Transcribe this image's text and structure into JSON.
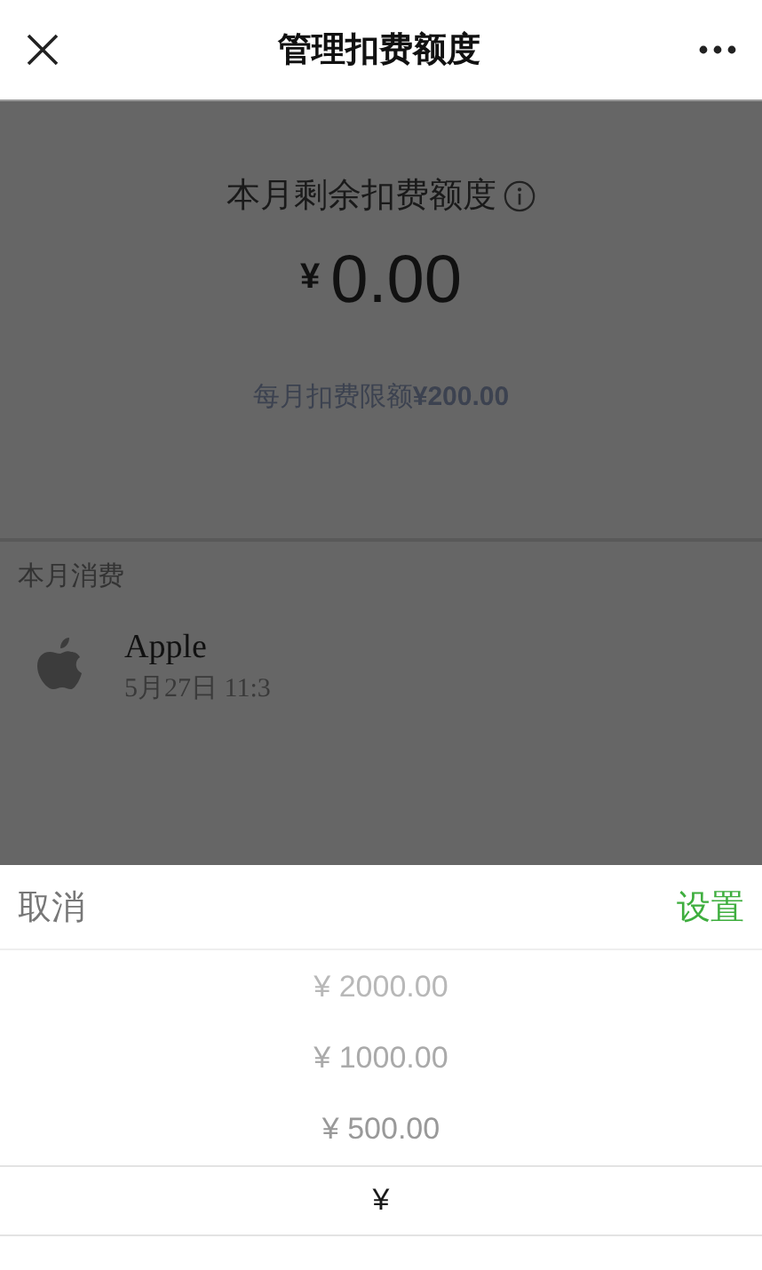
{
  "nav": {
    "title": "管理扣费额度"
  },
  "summary": {
    "label": "本月剩余扣费额度",
    "currency": "¥",
    "amount": "0.00",
    "limit": "每月扣费限额**¥200.00**"
  },
  "spending": {
    "heading": "本月消费",
    "items": [
      {
        "name": "Apple",
        "time": "5月27日 11:3"
      }
    ]
  },
  "picker": {
    "cancel": "取消",
    "confirm": "设置",
    "options": [
      {
        "label": "¥ 2000.00",
        "selected": false
      },
      {
        "label": "¥ 1000.00",
        "selected": false
      },
      {
        "label": "¥ 500.00",
        "selected": false
      },
      {
        "label": "¥",
        "selected": true
      }
    ]
  }
}
